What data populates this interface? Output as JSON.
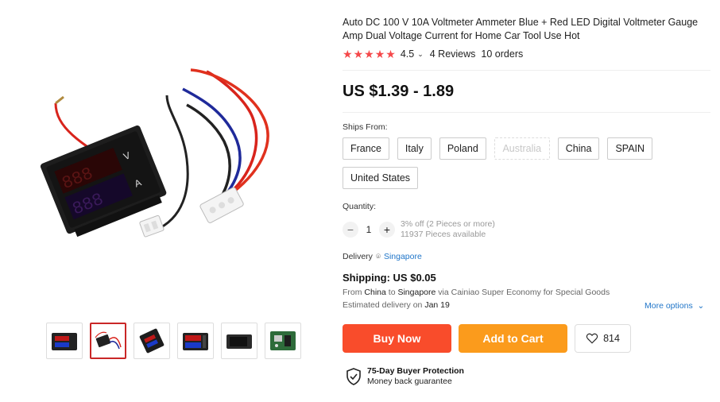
{
  "product": {
    "title": "Auto DC 100 V 10A Voltmeter Ammeter Blue + Red LED Digital Voltmeter Gauge Amp Dual Voltage Current for Home Car Tool Use Hot",
    "rating": "4.5",
    "reviews": "4 Reviews",
    "orders": "10 orders",
    "price": "US $1.39 - 1.89",
    "rating_color": "#f5484a"
  },
  "ships_from": {
    "label": "Ships From:",
    "options": [
      "France",
      "Italy",
      "Poland",
      "Australia",
      "China",
      "SPAIN",
      "United States"
    ],
    "disabled": "Australia"
  },
  "quantity": {
    "label": "Quantity:",
    "value": "1",
    "discount": "3% off (2 Pieces or more)",
    "available": "11937 Pieces available"
  },
  "delivery": {
    "label": "Delivery",
    "location": "Singapore"
  },
  "shipping": {
    "title": "Shipping: US $0.05",
    "from_text": "From",
    "from": "China",
    "to_text": "to",
    "to": "Singapore",
    "via": "via Cainiao Super Economy for Special Goods",
    "estimated_text": "Estimated delivery on",
    "estimated_date": "Jan 19",
    "more_options": "More options"
  },
  "actions": {
    "buy_now": "Buy Now",
    "add_to_cart": "Add to Cart",
    "wishlist_count": "814"
  },
  "protection": {
    "title": "75-Day Buyer Protection",
    "subtitle": "Money back guarantee"
  },
  "colors": {
    "buy_now": "#f94c2b",
    "add_to_cart": "#fb9b1c",
    "link": "#2176c9",
    "active_thumb": "#c92727"
  }
}
